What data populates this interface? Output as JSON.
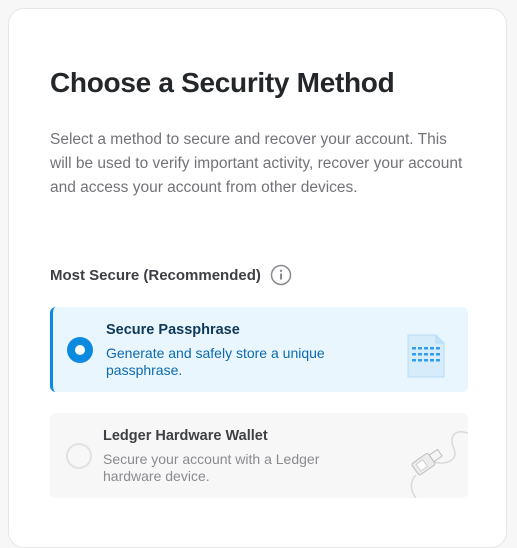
{
  "header": {
    "title": "Choose a Security Method",
    "description": "Select a method to secure and recover your account. This will be used to verify important activity, recover your account and access your account from other devices."
  },
  "section": {
    "label": "Most Secure (Recommended)",
    "info_icon": "info-icon"
  },
  "options": [
    {
      "title": "Secure Passphrase",
      "description": "Generate and safely store a unique passphrase.",
      "selected": true,
      "icon": "passphrase-document-icon"
    },
    {
      "title": "Ledger Hardware Wallet",
      "description": "Secure your account with a Ledger hardware device.",
      "selected": false,
      "icon": "usb-device-icon"
    }
  ],
  "colors": {
    "accent": "#0b8be0",
    "selected_bg": "#eaf6fe",
    "title": "#24272a",
    "muted": "#72727a"
  }
}
